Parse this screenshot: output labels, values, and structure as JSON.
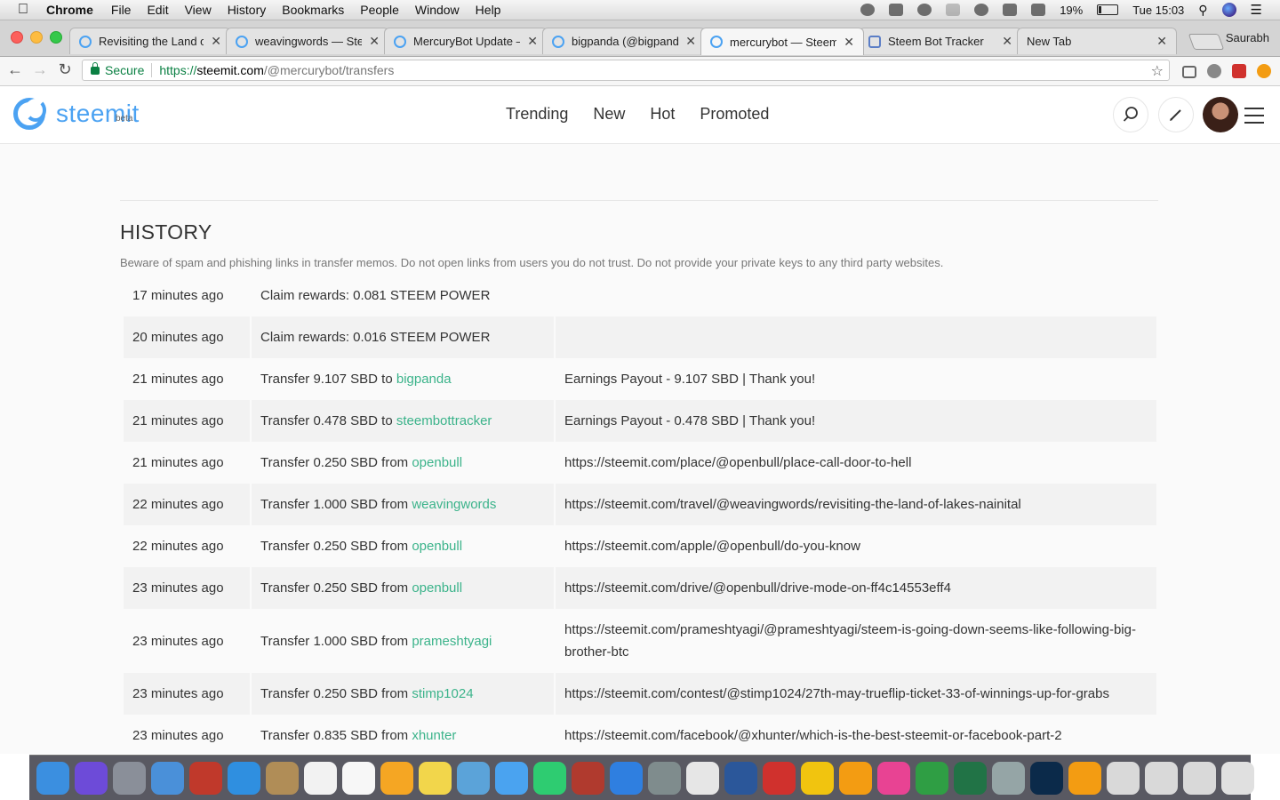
{
  "menubar": {
    "app_name": "Chrome",
    "items": [
      "File",
      "Edit",
      "View",
      "History",
      "Bookmarks",
      "People",
      "Window",
      "Help"
    ],
    "battery": "19%",
    "clock": "Tue 15:03"
  },
  "tabs": [
    {
      "title": "Revisiting the Land of",
      "active": false,
      "icon": "steemit-icon"
    },
    {
      "title": "weavingwords — Stee",
      "active": false,
      "icon": "steemit-icon"
    },
    {
      "title": "MercuryBot Update —",
      "active": false,
      "icon": "steemit-icon"
    },
    {
      "title": "bigpanda (@bigpanda",
      "active": false,
      "icon": "steemit-icon"
    },
    {
      "title": "mercurybot — Steemi",
      "active": true,
      "icon": "steemit-icon"
    },
    {
      "title": "Steem Bot Tracker",
      "active": false,
      "icon": "tracker-icon"
    },
    {
      "title": "New Tab",
      "active": false,
      "icon": "none"
    }
  ],
  "profile_name": "Saurabh",
  "address_bar": {
    "secure_label": "Secure",
    "scheme": "https://",
    "host": "steemit.com",
    "path": "/@mercurybot/transfers"
  },
  "site": {
    "logo_text": "steemit",
    "logo_beta": "beta",
    "nav": [
      "Trending",
      "New",
      "Hot",
      "Promoted"
    ]
  },
  "history": {
    "title": "HISTORY",
    "warning": "Beware of spam and phishing links in transfer memos. Do not open links from users you do not trust. Do not provide your private keys to any third party websites.",
    "rows": [
      {
        "time": "17 minutes ago",
        "action": "Claim rewards: 0.081 STEEM POWER",
        "user": "",
        "memo": ""
      },
      {
        "time": "20 minutes ago",
        "action": "Claim rewards: 0.016 STEEM POWER",
        "user": "",
        "memo": ""
      },
      {
        "time": "21 minutes ago",
        "action": "Transfer 9.107 SBD to ",
        "user": "bigpanda",
        "memo": "Earnings Payout - 9.107 SBD | Thank you!"
      },
      {
        "time": "21 minutes ago",
        "action": "Transfer 0.478 SBD to ",
        "user": "steembottracker",
        "memo": "Earnings Payout - 0.478 SBD | Thank you!"
      },
      {
        "time": "21 minutes ago",
        "action": "Transfer 0.250 SBD from ",
        "user": "openbull",
        "memo": "https://steemit.com/place/@openbull/place-call-door-to-hell"
      },
      {
        "time": "22 minutes ago",
        "action": "Transfer 1.000 SBD from ",
        "user": "weavingwords",
        "memo": "https://steemit.com/travel/@weavingwords/revisiting-the-land-of-lakes-nainital"
      },
      {
        "time": "22 minutes ago",
        "action": "Transfer 0.250 SBD from ",
        "user": "openbull",
        "memo": "https://steemit.com/apple/@openbull/do-you-know"
      },
      {
        "time": "23 minutes ago",
        "action": "Transfer 0.250 SBD from ",
        "user": "openbull",
        "memo": "https://steemit.com/drive/@openbull/drive-mode-on-ff4c14553eff4"
      },
      {
        "time": "23 minutes ago",
        "action": "Transfer 1.000 SBD from ",
        "user": "prameshtyagi",
        "memo": "https://steemit.com/prameshtyagi/@prameshtyagi/steem-is-going-down-seems-like-following-big-brother-btc"
      },
      {
        "time": "23 minutes ago",
        "action": "Transfer 0.250 SBD from ",
        "user": "stimp1024",
        "memo": "https://steemit.com/contest/@stimp1024/27th-may-trueflip-ticket-33-of-winnings-up-for-grabs"
      },
      {
        "time": "23 minutes ago",
        "action": "Transfer 0.835 SBD from ",
        "user": "xhunter",
        "memo": "https://steemit.com/facebook/@xhunter/which-is-the-best-steemit-or-facebook-part-2"
      }
    ]
  },
  "dock_icons": [
    "finder-icon",
    "siri-icon",
    "launchpad-icon",
    "mail-icon",
    "photo-booth-icon",
    "safari-icon",
    "contacts-icon",
    "calendar-icon",
    "reminders-icon",
    "photos-icon",
    "notes-icon",
    "preview-icon",
    "messages-icon",
    "facetime-icon",
    "photo-booth-icon",
    "app-store-icon",
    "system-preferences-icon",
    "launcher-icon",
    "word-icon",
    "acrobat-icon",
    "chrome-icon",
    "ibooks-icon",
    "itunes-icon",
    "evernote-icon",
    "excel-icon",
    "image-capture-icon",
    "photoshop-icon",
    "vlc-icon",
    "documents-icon",
    "downloads-icon",
    "folder-icon",
    "trash-icon"
  ],
  "colors": {
    "accent": "#4ba2f2",
    "link": "#3bb38a"
  }
}
